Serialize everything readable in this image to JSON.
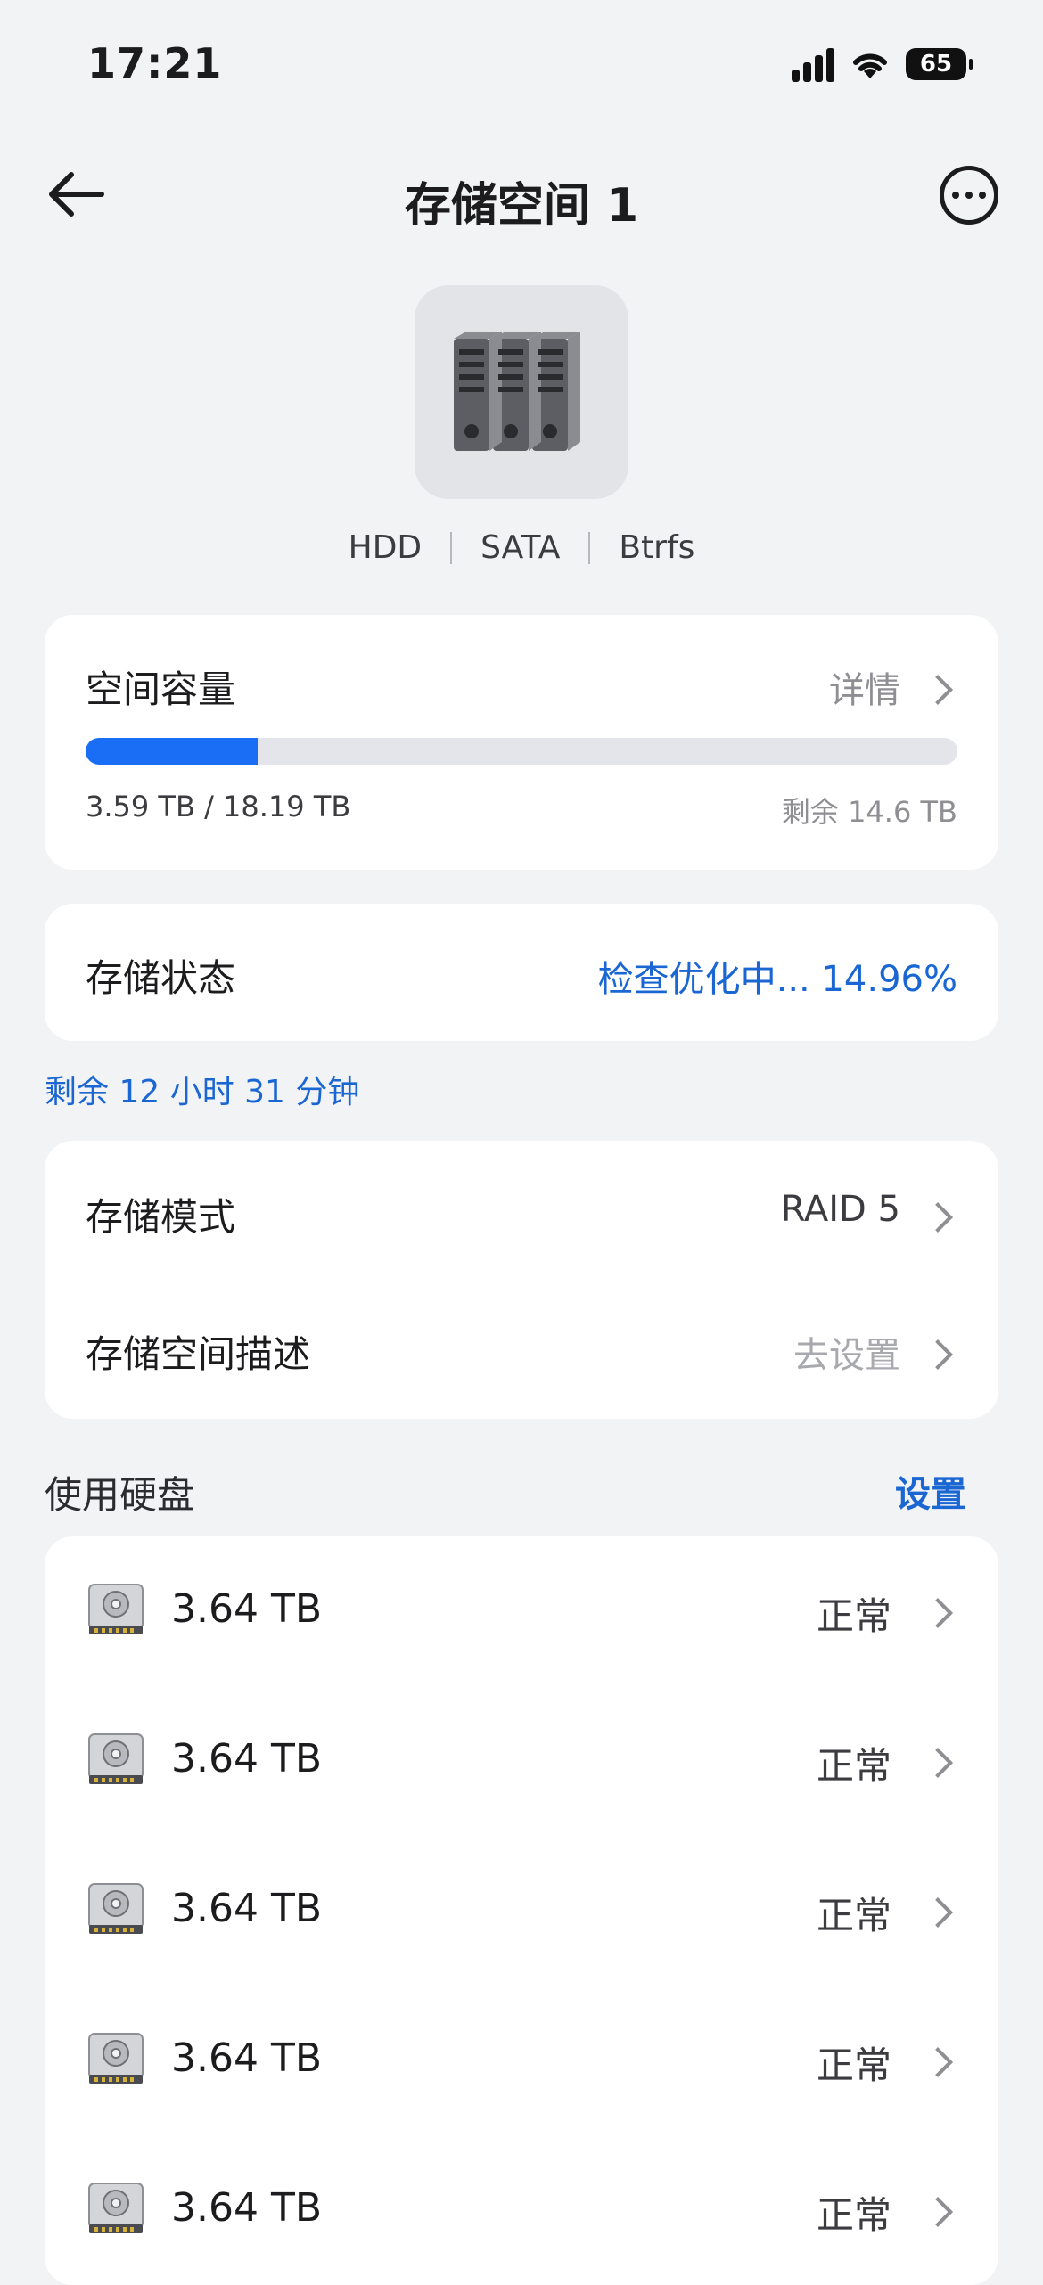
{
  "status_bar": {
    "time": "17:21",
    "battery": "65"
  },
  "nav": {
    "title": "存储空间 1"
  },
  "device": {
    "tags": [
      "HDD",
      "SATA",
      "Btrfs"
    ]
  },
  "capacity": {
    "label": "空间容量",
    "detail": "详情",
    "used_total": "3.59 TB / 18.19 TB",
    "remaining": "剩余 14.6 TB",
    "used_fraction": 0.197
  },
  "state": {
    "label": "存储状态",
    "value": "检查优化中... 14.96%"
  },
  "remaining_time": "剩余 12 小时 31 分钟",
  "mode": {
    "label": "存储模式",
    "value": "RAID 5",
    "desc_label": "存储空间描述",
    "desc_value": "去设置"
  },
  "disks": {
    "header": "使用硬盘",
    "settings": "设置",
    "items": [
      {
        "size": "3.64 TB",
        "status": "正常"
      },
      {
        "size": "3.64 TB",
        "status": "正常"
      },
      {
        "size": "3.64 TB",
        "status": "正常"
      },
      {
        "size": "3.64 TB",
        "status": "正常"
      },
      {
        "size": "3.64 TB",
        "status": "正常"
      }
    ]
  },
  "colors": {
    "accent": "#1a6df5",
    "link": "#1a66d2",
    "background": "#f2f3f5"
  }
}
